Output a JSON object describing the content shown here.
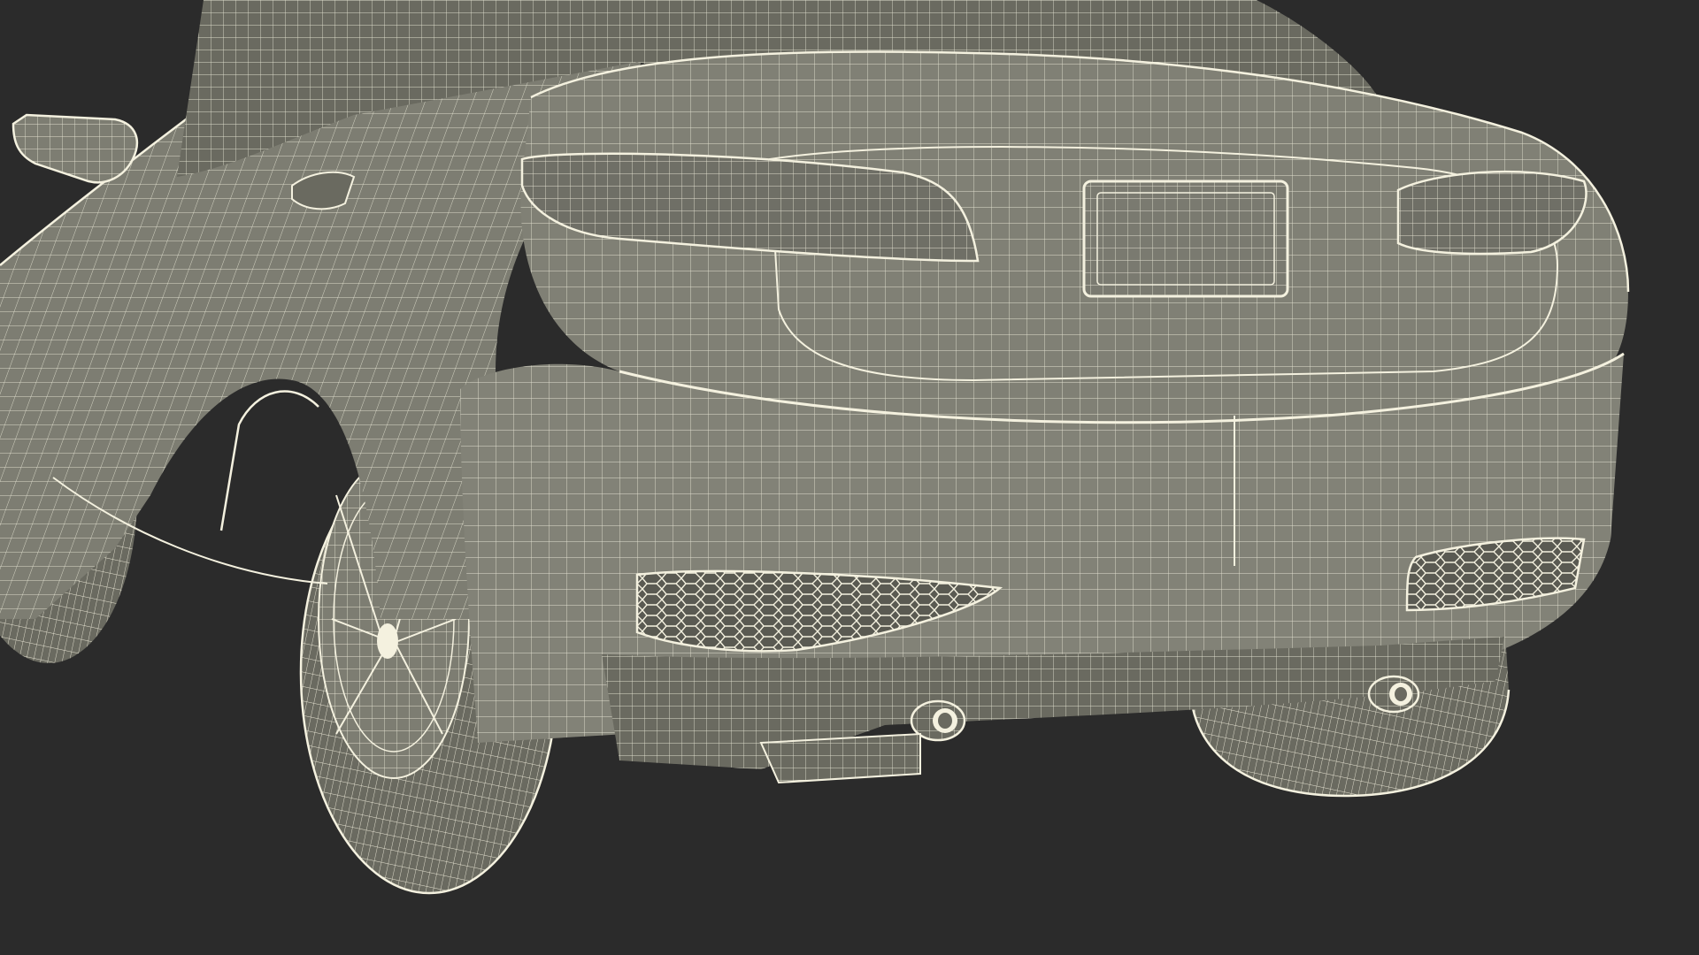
{
  "scene": {
    "subject": "car-rear-wireframe",
    "colors": {
      "background": "#2b2b2b",
      "surface": "#7d7d72",
      "surface_dark": "#6a6a60",
      "surface_shadow": "#55554d",
      "wire": "#f4f1df",
      "wire_dim": "#d8d5c4"
    }
  }
}
